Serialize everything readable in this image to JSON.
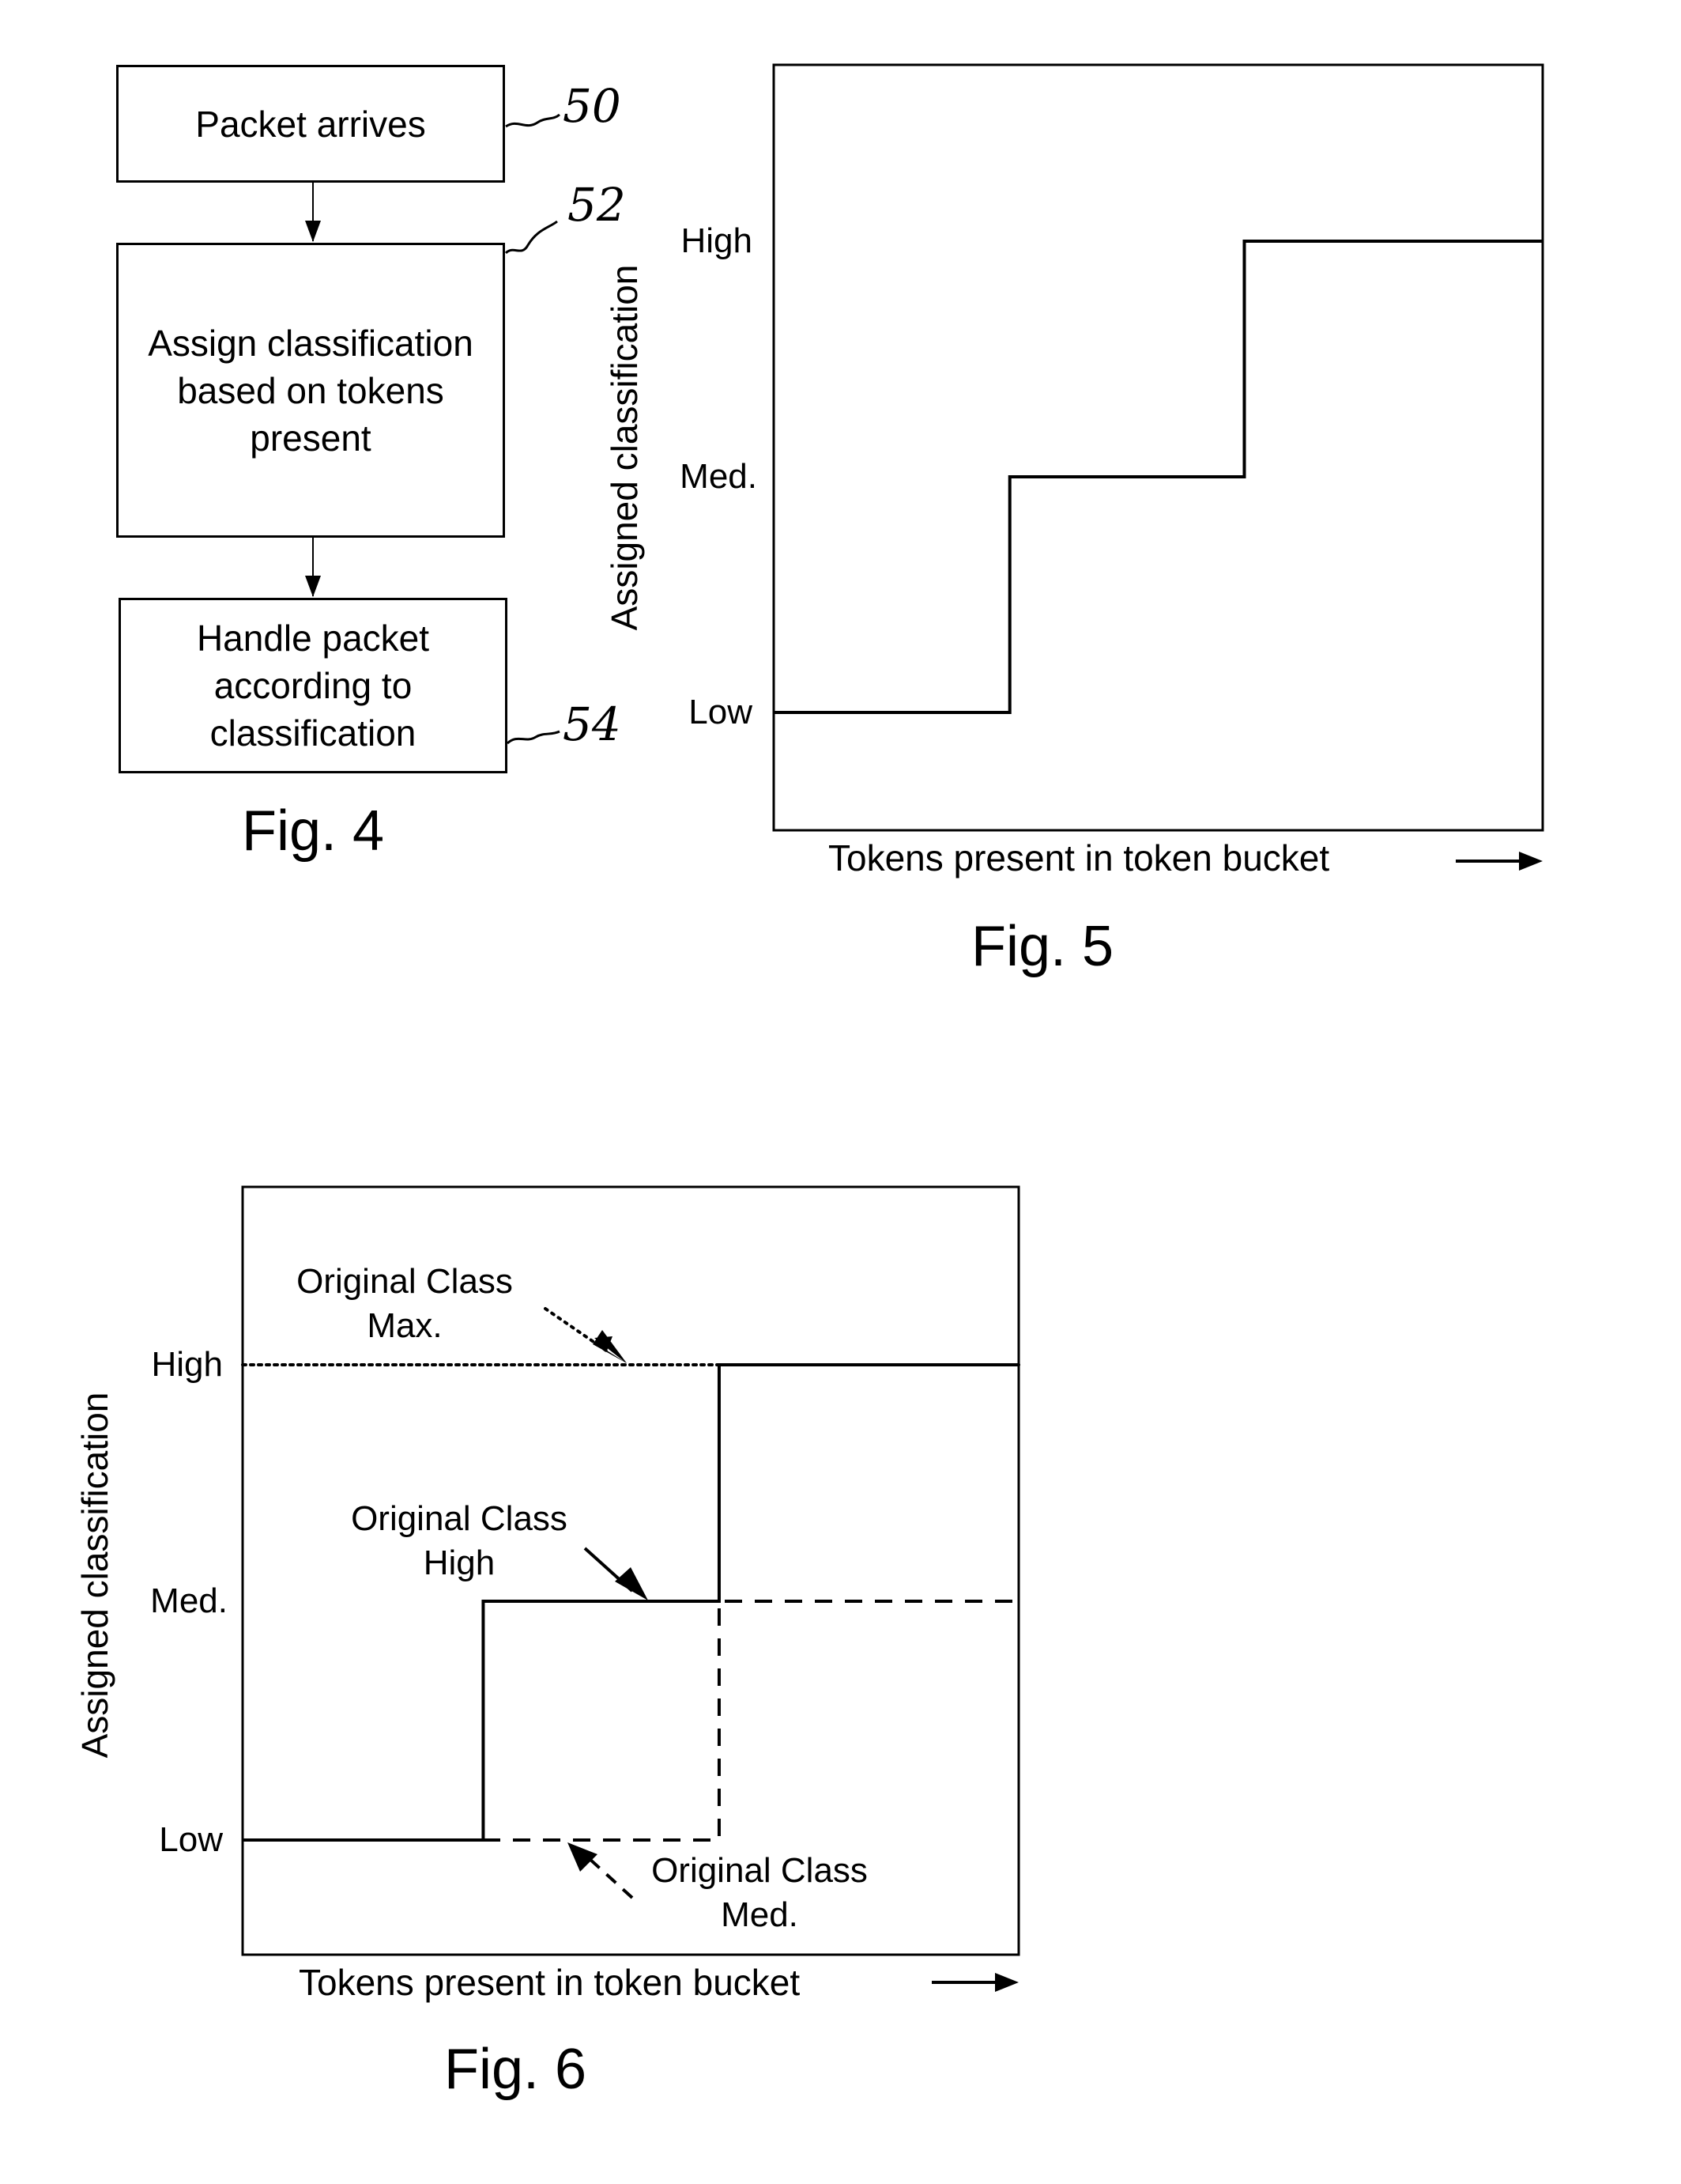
{
  "fig4": {
    "caption": "Fig. 4",
    "steps": [
      {
        "ref": "50",
        "text": "Packet arrives"
      },
      {
        "ref": "52",
        "text": "Assign classification\nbased on tokens\npresent"
      },
      {
        "ref": "54",
        "text": "Handle packet\naccording to\nclassification"
      }
    ]
  },
  "chart_data": [
    {
      "type": "line",
      "title": "Fig. 5",
      "xlabel": "Tokens present in token bucket",
      "ylabel": "Assigned classification",
      "yticks": [
        "Low",
        "Med.",
        "High"
      ],
      "xlim": [
        0,
        1
      ],
      "series": [
        {
          "name": "Assigned classification",
          "style": "solid",
          "step": true,
          "x": [
            0,
            0.307,
            0.307,
            0.612,
            0.612,
            1.0
          ],
          "y": [
            "Low",
            "Low",
            "Med.",
            "Med.",
            "High",
            "High"
          ]
        }
      ]
    },
    {
      "type": "line",
      "title": "Fig. 6",
      "xlabel": "Tokens present in token bucket",
      "ylabel": "Assigned classification",
      "yticks": [
        "Low",
        "Med.",
        "High"
      ],
      "xlim": [
        0,
        1
      ],
      "series": [
        {
          "name": "Original Class Max.",
          "style": "dotted",
          "step": true,
          "x": [
            0,
            1.0
          ],
          "y": [
            "High",
            "High"
          ]
        },
        {
          "name": "Original Class High",
          "style": "solid",
          "step": true,
          "x": [
            0,
            0.31,
            0.31,
            0.614,
            0.614,
            1.0
          ],
          "y": [
            "Low",
            "Low",
            "Med.",
            "Med.",
            "High",
            "High"
          ]
        },
        {
          "name": "Original Class Med.",
          "style": "dashed",
          "step": true,
          "x": [
            0,
            0.614,
            0.614,
            1.0
          ],
          "y": [
            "Low",
            "Low",
            "Med.",
            "Med."
          ]
        }
      ],
      "annotations": [
        {
          "text": "Original Class\nMax.",
          "target": "Original Class Max."
        },
        {
          "text": "Original Class\nHigh",
          "target": "Original Class High"
        },
        {
          "text": "Original Class\nMed.",
          "target": "Original Class Med."
        }
      ]
    }
  ]
}
